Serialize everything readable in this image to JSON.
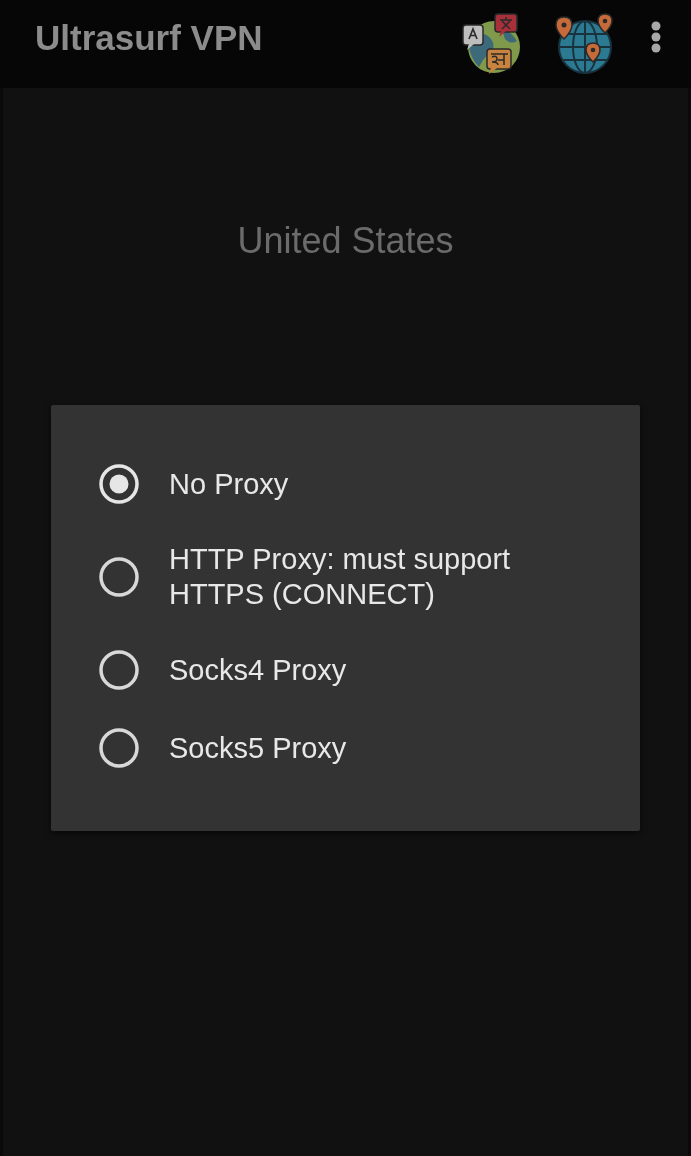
{
  "app_bar": {
    "title": "Ultrasurf VPN"
  },
  "main": {
    "country": "United States"
  },
  "proxy_dialog": {
    "options": [
      {
        "label": "No Proxy",
        "selected": true
      },
      {
        "label": "HTTP Proxy: must support HTTPS (CONNECT)",
        "selected": false
      },
      {
        "label": "Socks4 Proxy",
        "selected": false
      },
      {
        "label": "Socks5 Proxy",
        "selected": false
      }
    ]
  }
}
